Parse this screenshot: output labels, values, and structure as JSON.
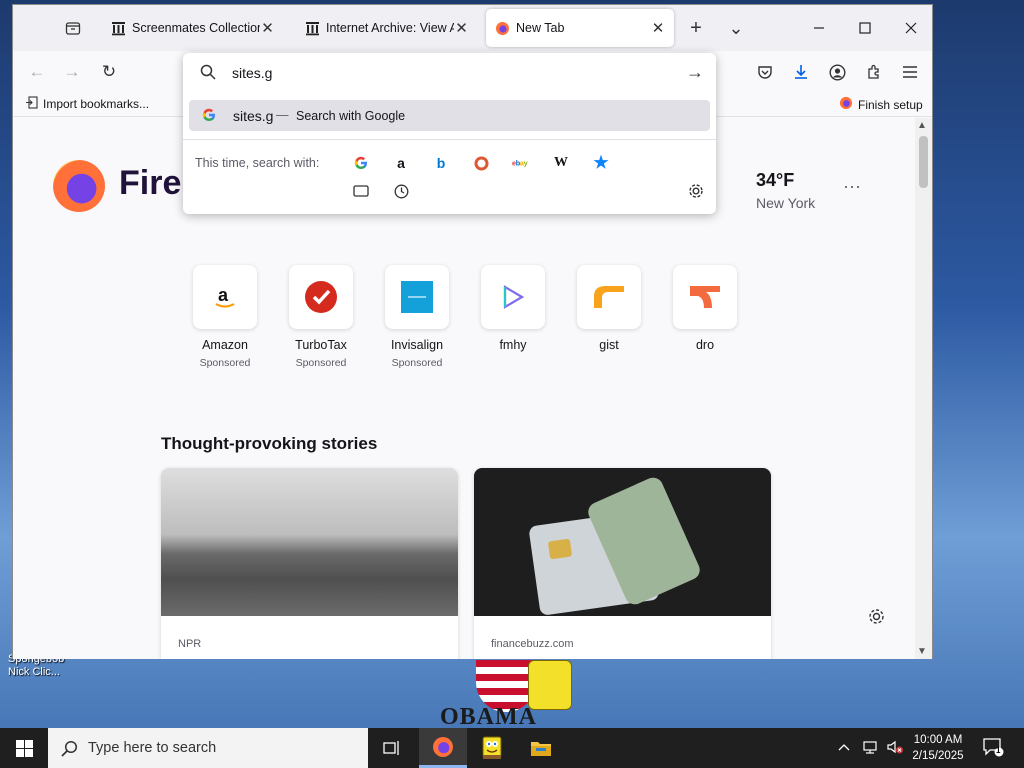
{
  "desktop": {
    "icon_label_line1": "Spongebob",
    "icon_label_line2": "Nick Clic..."
  },
  "browser": {
    "tabs": [
      {
        "title": "Screenmates Collection Bo",
        "active": false
      },
      {
        "title": "Internet Archive: View Arc",
        "active": false
      },
      {
        "title": "New Tab",
        "active": true
      }
    ],
    "close_glyph": "✕",
    "new_tab_glyph": "+",
    "list_tabs_glyph": "⌄",
    "bookmarks": {
      "import_label": "Import bookmarks...",
      "finish_setup_label": "Finish setup"
    },
    "urlbar": {
      "value": "sites.g",
      "go_glyph": "→",
      "suggestion": {
        "query": "sites.g",
        "separator": "—",
        "action": "Search with Google"
      },
      "oneoff_label": "This time, search with:",
      "engines": [
        "google-icon",
        "amazon-icon",
        "bing-icon",
        "duckduckgo-icon",
        "ebay-icon",
        "wikipedia-icon",
        "bookmarks-star-icon",
        "tabs-icon",
        "history-icon"
      ]
    },
    "newtab": {
      "logo_text": "Fire",
      "weather": {
        "temp": "34°F",
        "city": "New York"
      },
      "more_glyph": "···",
      "top_sites": [
        {
          "name": "Amazon",
          "sponsored": "Sponsored"
        },
        {
          "name": "TurboTax",
          "sponsored": "Sponsored"
        },
        {
          "name": "Invisalign",
          "sponsored": "Sponsored"
        },
        {
          "name": "fmhy",
          "sponsored": ""
        },
        {
          "name": "gist",
          "sponsored": ""
        },
        {
          "name": "dro",
          "sponsored": ""
        }
      ],
      "stories_title": "Thought-provoking stories",
      "stories": [
        {
          "source": "NPR"
        },
        {
          "source": "financebuzz.com"
        }
      ]
    }
  },
  "poster_text": "OBAMA",
  "taskbar": {
    "search_placeholder": "Type here to search",
    "time": "10:00 AM",
    "date": "2/15/2025",
    "notification_count": "1"
  },
  "colors": {
    "accent": "#0061e0",
    "firefox_orange": "#ff7139",
    "firefox_purple": "#7542e5"
  }
}
